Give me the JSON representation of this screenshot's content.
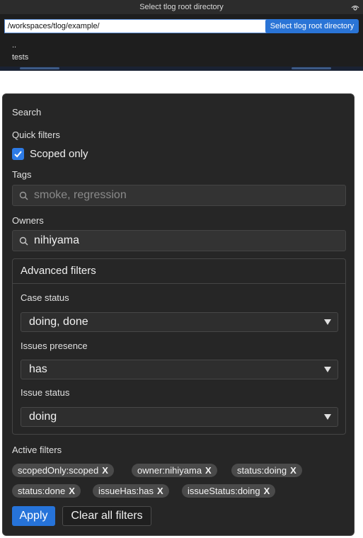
{
  "picker": {
    "title": "Select tlog root directory",
    "path_value": "/workspaces/tlog/example/",
    "select_button": "Select tlog root directory",
    "entries": [
      "..",
      "tests"
    ]
  },
  "panel": {
    "search_heading": "Search",
    "quick_filters_label": "Quick filters",
    "scoped_only": {
      "label": "Scoped only",
      "checked": true
    },
    "tags": {
      "label": "Tags",
      "value": "",
      "placeholder": "smoke, regression"
    },
    "owners": {
      "label": "Owners",
      "value": "nihiyama",
      "placeholder": ""
    },
    "advanced": {
      "title": "Advanced filters",
      "case_status": {
        "label": "Case status",
        "value": "doing, done"
      },
      "issues_presence": {
        "label": "Issues presence",
        "value": "has"
      },
      "issue_status": {
        "label": "Issue status",
        "value": "doing"
      }
    },
    "active_filters_label": "Active filters",
    "chips": [
      {
        "text": "scopedOnly:scoped",
        "remove": "X"
      },
      {
        "text": "owner:nihiyama",
        "remove": "X"
      },
      {
        "text": "status:doing",
        "remove": "X"
      },
      {
        "text": "status:done",
        "remove": "X"
      },
      {
        "text": "issueHas:has",
        "remove": "X"
      },
      {
        "text": "issueStatus:doing",
        "remove": "X"
      }
    ],
    "apply_button": "Apply",
    "clear_button": "Clear all filters"
  },
  "colors": {
    "accent": "#2673d9",
    "panel_bg": "#262626",
    "chip_bg": "#4a4a4a"
  }
}
